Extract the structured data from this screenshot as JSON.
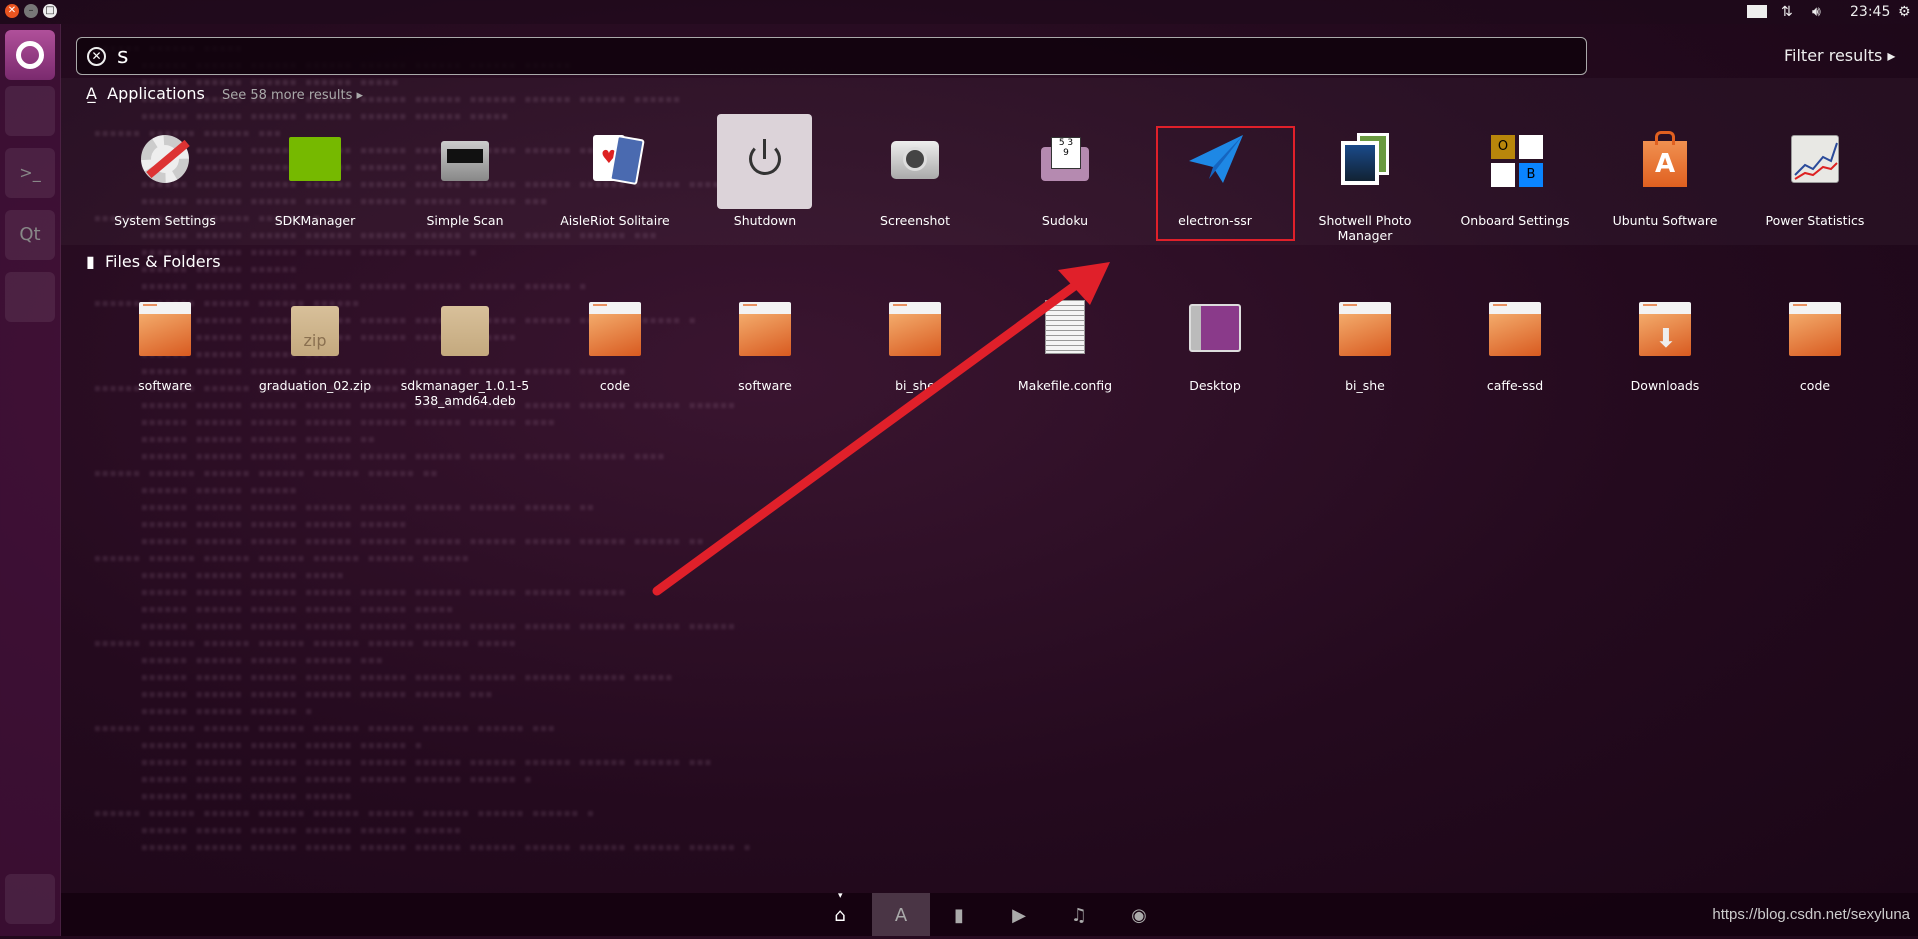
{
  "topbar": {
    "time": "23:45",
    "icons": [
      "keyboard-icon",
      "network-icon",
      "volume-icon",
      "gear-icon"
    ]
  },
  "window_controls": [
    "close",
    "minimize",
    "maximize"
  ],
  "launcher": {
    "items": [
      "ubuntu-dash",
      "files",
      "terminal",
      "qt-creator",
      "chromium",
      "trash"
    ]
  },
  "search": {
    "value": "s"
  },
  "filter_label": "Filter results",
  "applications": {
    "title": "Applications",
    "more": "See 58 more results",
    "items": [
      {
        "label": "System Settings"
      },
      {
        "label": "SDKManager"
      },
      {
        "label": "Simple Scan"
      },
      {
        "label": "AisleRiot Solitaire"
      },
      {
        "label": "Shutdown"
      },
      {
        "label": "Screenshot"
      },
      {
        "label": "Sudoku"
      },
      {
        "label": "electron-ssr"
      },
      {
        "label": "Shotwell Photo Manager"
      },
      {
        "label": "Onboard Settings"
      },
      {
        "label": "Ubuntu Software"
      },
      {
        "label": "Power Statistics"
      }
    ]
  },
  "onboard_letters": {
    "o": "O",
    "b": "B"
  },
  "files": {
    "title": "Files & Folders",
    "items": [
      {
        "label": "software",
        "type": "folder"
      },
      {
        "label": "graduation_02.zip",
        "type": "zip",
        "badge": "zip"
      },
      {
        "label": "sdkmanager_1.0.1-5538_amd64.deb",
        "type": "package"
      },
      {
        "label": "code",
        "type": "folder"
      },
      {
        "label": "software",
        "type": "folder"
      },
      {
        "label": "bi_she",
        "type": "folder"
      },
      {
        "label": "Makefile.config",
        "type": "text"
      },
      {
        "label": "Desktop",
        "type": "desktop"
      },
      {
        "label": "bi_she",
        "type": "folder"
      },
      {
        "label": "caffe-ssd",
        "type": "folder"
      },
      {
        "label": "Downloads",
        "type": "downloads"
      },
      {
        "label": "code",
        "type": "folder"
      }
    ]
  },
  "lenses": [
    "home",
    "applications",
    "files",
    "video",
    "music",
    "photos"
  ],
  "annotation": {
    "color": "#e0202a"
  },
  "watermark": "https://blog.csdn.net/sexyluna"
}
